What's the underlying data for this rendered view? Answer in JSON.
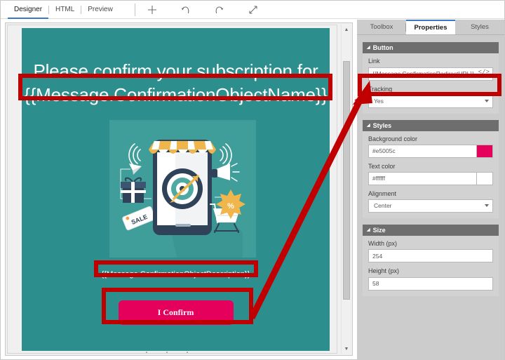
{
  "toolbar": {
    "view_tabs": [
      {
        "label": "Designer",
        "active": true
      },
      {
        "label": "HTML",
        "active": false
      },
      {
        "label": "Preview",
        "active": false
      }
    ],
    "actions": [
      {
        "name": "add-icon",
        "label": "Add"
      },
      {
        "name": "undo-icon",
        "label": "Undo"
      },
      {
        "name": "redo-icon",
        "label": "Redo"
      },
      {
        "name": "fullscreen-icon",
        "label": "Full screen"
      }
    ]
  },
  "canvas": {
    "background_color": "#2d8e8e",
    "heading_line1": "Please confirm your subscription for",
    "heading_line2": "{{Message.ConfirmationObjectName}}",
    "description": "{{Message.ConfirmationObjectDescription}}",
    "button_label": "I Confirm",
    "button_color": "#e5005c",
    "illustration": {
      "name": "mobile-marketing-illustration",
      "elements": [
        "smartphone",
        "shop-awning",
        "dartboard-target",
        "arrow",
        "gift-box",
        "sale-tag",
        "megaphone",
        "shopping-cart",
        "percent-badge",
        "paper-plane",
        "wifi-signal"
      ]
    }
  },
  "right_panel": {
    "tabs": [
      {
        "label": "Toolbox",
        "active": false
      },
      {
        "label": "Properties",
        "active": true
      },
      {
        "label": "Styles",
        "active": false
      }
    ],
    "sections": [
      {
        "title": "Button",
        "fields": [
          {
            "label": "Link",
            "value": "{{Message.ConfirmationRedirectURL}}",
            "type": "text-code"
          },
          {
            "label": "Tracking",
            "value": "Yes",
            "type": "select"
          }
        ]
      },
      {
        "title": "Styles",
        "fields": [
          {
            "label": "Background color",
            "value": "#e5005c",
            "type": "color"
          },
          {
            "label": "Text color",
            "value": "#ffffff",
            "type": "color"
          },
          {
            "label": "Alignment",
            "value": "Center",
            "type": "select"
          }
        ]
      },
      {
        "title": "Size",
        "fields": [
          {
            "label": "Width (px)",
            "value": "254",
            "type": "text"
          },
          {
            "label": "Height (px)",
            "value": "58",
            "type": "text"
          }
        ]
      }
    ]
  },
  "annotations": {
    "color": "#c00000",
    "boxes": [
      "heading-highlight",
      "description-highlight",
      "button-highlight",
      "link-field-highlight"
    ],
    "arrow": "button-to-link-arrow"
  }
}
